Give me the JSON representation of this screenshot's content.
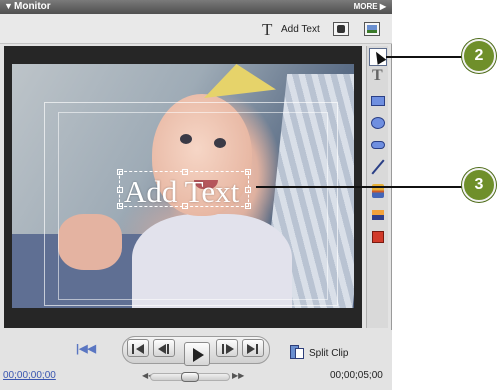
{
  "window": {
    "title": "Monitor",
    "more_label": "MORE"
  },
  "toolbar": {
    "add_text_label": "Add Text"
  },
  "video_text": "Add Text",
  "tools": [
    "selection-tool",
    "text-tool",
    "rectangle-tool",
    "ellipse-tool",
    "rounded-rectangle-tool",
    "line-tool",
    "color-tool",
    "shadow-tool",
    "stop-tool"
  ],
  "transport": {
    "split_clip_label": "Split Clip",
    "timecode_current": "00;00;00;00",
    "timecode_duration": "00;00;05;00"
  },
  "callouts": {
    "c2": "2",
    "c3": "3"
  },
  "colors": {
    "callout": "#6f8f2a",
    "title_bar": "#5a5a5a",
    "accent": "#5a76c2"
  }
}
